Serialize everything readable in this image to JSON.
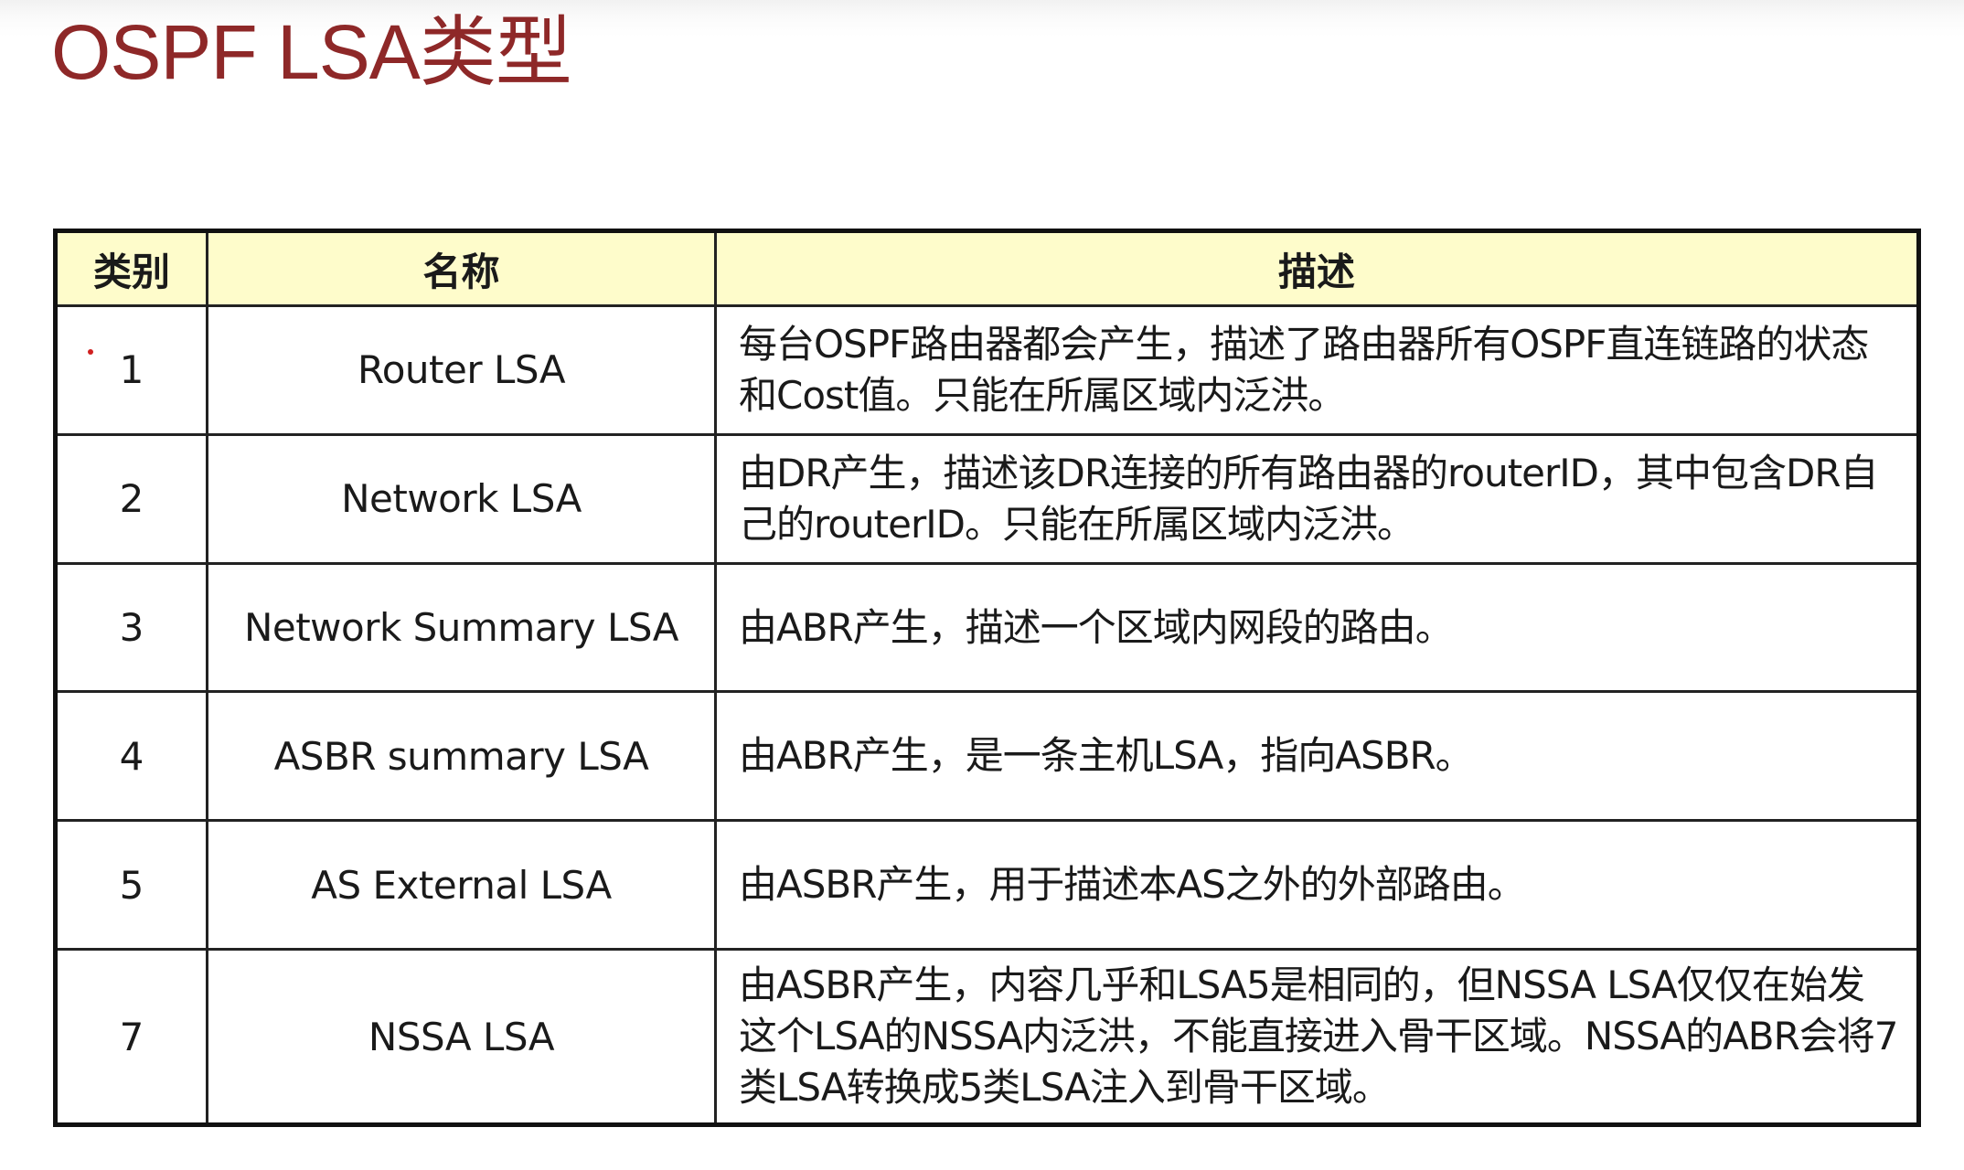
{
  "title": "OSPF LSA类型",
  "table": {
    "headers": {
      "type": "类别",
      "name": "名称",
      "description": "描述"
    },
    "rows": [
      {
        "type": "1",
        "name": "Router LSA",
        "description": "每台OSPF路由器都会产生，描述了路由器所有OSPF直连链路的状态和Cost值。只能在所属区域内泛洪。"
      },
      {
        "type": "2",
        "name": "Network LSA",
        "description": "由DR产生，描述该DR连接的所有路由器的routerID，其中包含DR自己的routerID。只能在所属区域内泛洪。"
      },
      {
        "type": "3",
        "name": "Network Summary LSA",
        "description": "由ABR产生，描述一个区域内网段的路由。"
      },
      {
        "type": "4",
        "name": "ASBR summary LSA",
        "description": "由ABR产生，是一条主机LSA，指向ASBR。"
      },
      {
        "type": "5",
        "name": "AS External LSA",
        "description": "由ASBR产生，用于描述本AS之外的外部路由。"
      },
      {
        "type": "7",
        "name": "NSSA LSA",
        "description": "由ASBR产生，内容几乎和LSA5是相同的，但NSSA LSA仅仅在始发这个LSA的NSSA内泛洪，不能直接进入骨干区域。NSSA的ABR会将7类LSA转换成5类LSA注入到骨干区域。"
      }
    ]
  },
  "colors": {
    "title": "#8e2828",
    "header_bg": "#fefccb",
    "border": "#111111",
    "marker": "#d02020"
  }
}
